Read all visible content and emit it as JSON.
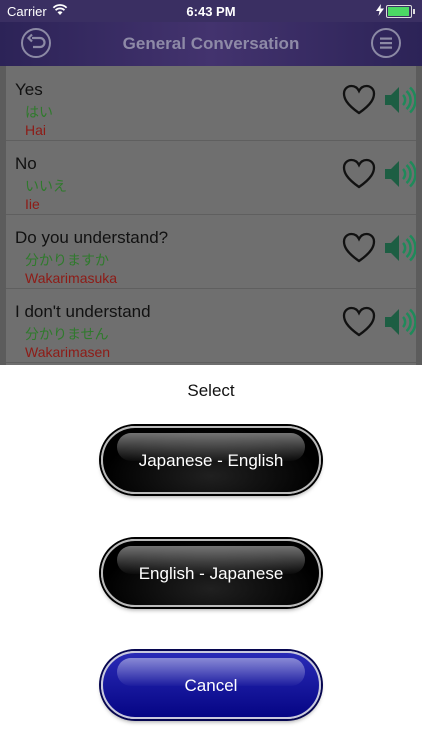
{
  "status": {
    "carrier": "Carrier",
    "time": "6:43 PM"
  },
  "nav": {
    "title": "General Conversation"
  },
  "phrases": [
    {
      "english": "Yes",
      "japanese": "はい",
      "romaji": "Hai"
    },
    {
      "english": "No",
      "japanese": "いいえ",
      "romaji": "Iie"
    },
    {
      "english": "Do you understand?",
      "japanese": "分かりますか",
      "romaji": "Wakarimasuka"
    },
    {
      "english": "I don't understand",
      "japanese": "分かりません",
      "romaji": "Wakarimasen"
    }
  ],
  "sheet": {
    "title": "Select",
    "options": [
      "Japanese - English",
      "English - Japanese"
    ],
    "cancel": "Cancel"
  },
  "colors": {
    "nav_bg": "#2c2357",
    "japanese_text": "#2f7a2c",
    "romaji_text": "#8e1b16",
    "cancel_button": "#0a0a8c"
  }
}
